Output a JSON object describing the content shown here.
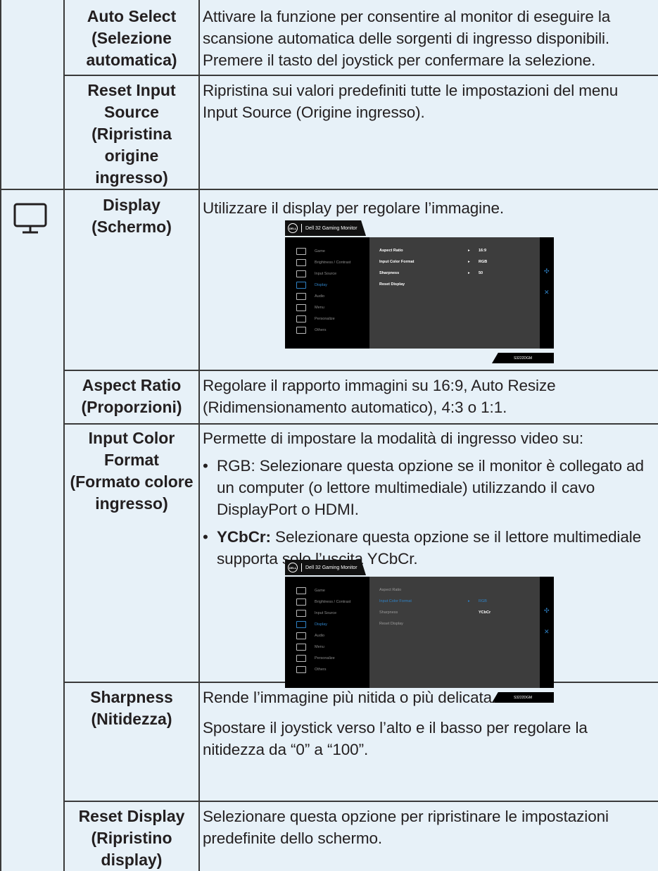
{
  "rows": {
    "auto_select": {
      "label": "Auto Select (Selezione automatica)",
      "desc": "Attivare la funzione per consentire al monitor di eseguire la scansione automatica delle sorgenti di ingresso disponibili. Premere il tasto del joystick per confermare la selezione."
    },
    "reset_input": {
      "label": "Reset Input Source (Ripristina origine ingresso)",
      "desc": "Ripristina sui valori predefiniti tutte le impostazioni del menu Input Source (Origine ingresso)."
    },
    "display": {
      "icon": "monitor-icon",
      "label": "Display (Schermo)",
      "desc": "Utilizzare il display per regolare l’immagine."
    },
    "aspect_ratio": {
      "label": "Aspect Ratio (Proporzioni)",
      "desc": "Regolare il rapporto immagini su 16:9, Auto Resize (Ridimensionamento automatico), 4:3 o 1:1."
    },
    "input_color": {
      "label": "Input Color Format (Formato colore ingresso)",
      "intro": "Permette di impostare la modalità di ingresso video su:",
      "b1_term": "RGB:",
      "b1_text": " Selezionare questa opzione se il monitor è collegato ad un computer (o lettore multimediale) utilizzando il cavo DisplayPort o HDMI.",
      "b2_term": "YCbCr:",
      "b2_text": " Selezionare questa opzione se il lettore multimediale supporta solo l’uscita YCbCr."
    },
    "sharpness": {
      "label": "Sharpness (Nitidezza)",
      "p1": "Rende l’immagine più nitida o più delicata.",
      "p2": "Spostare il joystick verso l’alto e il basso per regolare la nitidezza da “0” a “100”."
    },
    "reset_display": {
      "label": "Reset Display (Ripristino display)",
      "desc": "Selezionare questa opzione per ripristinare le impostazioni predefinite dello schermo."
    }
  },
  "osd": {
    "header_title": "Dell 32 Gaming Monitor",
    "logo_text": "DELL",
    "model": "S3222DGM",
    "menu": [
      "Game",
      "Brightness / Contrast",
      "Input Source",
      "Display",
      "Audio",
      "Menu",
      "Personalize",
      "Others"
    ],
    "active_menu": "Display",
    "screen1": {
      "items": [
        "Aspect Ratio",
        "Input Color Format",
        "Sharpness",
        "Reset Display"
      ],
      "values": [
        "16:9",
        "RGB",
        "50"
      ]
    },
    "screen2": {
      "items": [
        "Aspect Ratio",
        "Input Color Format",
        "Sharpness",
        "Reset Display"
      ],
      "opt1": "RGB",
      "opt2": "YCbCr"
    }
  }
}
